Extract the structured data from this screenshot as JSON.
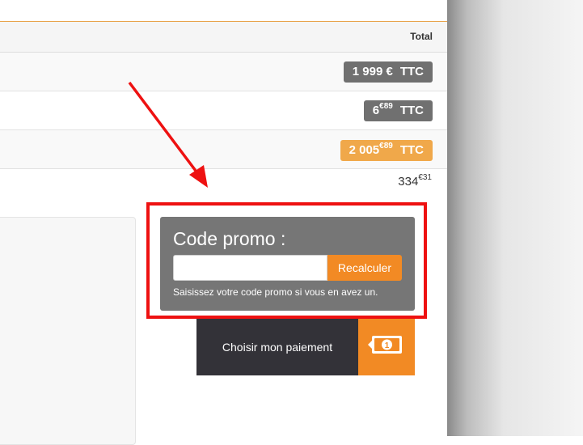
{
  "cart": {
    "header": {
      "total_label": "Total"
    },
    "rows": [
      {
        "amount": "1 999 €",
        "cents": "",
        "tax_label": "TTC",
        "style": "grey"
      },
      {
        "amount": "6",
        "cents": "€89",
        "tax_label": "TTC",
        "style": "grey"
      },
      {
        "amount": "2 005",
        "cents": "€89",
        "tax_label": "TTC",
        "style": "orange"
      }
    ],
    "extra_amount": {
      "amount": "334",
      "cents": "€31"
    }
  },
  "promo": {
    "title": "Code promo :",
    "input_value": "",
    "input_placeholder": "",
    "button_label": "Recalculer",
    "help_text": "Saisissez votre code promo si vous en avez un."
  },
  "payment": {
    "button_label": "Choisir mon paiement",
    "icon": "banknote-icon"
  },
  "annotation": {
    "highlight_color": "#ee1111",
    "arrow_color": "#ee1111"
  },
  "colors": {
    "accent_orange": "#f28a24",
    "total_orange": "#f0a84a",
    "badge_grey": "#707070",
    "promo_bg": "#767676",
    "pay_dark": "#333238"
  }
}
